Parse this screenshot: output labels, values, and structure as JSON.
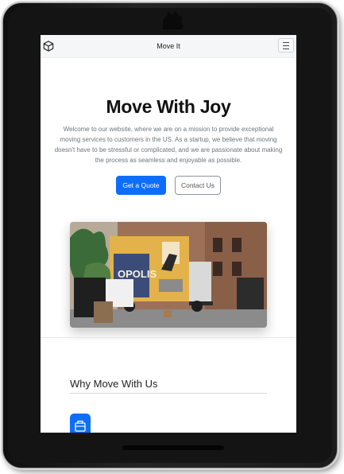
{
  "navbar": {
    "brand_icon": "box-icon",
    "title": "Move It",
    "menu_icon": "hamburger-icon"
  },
  "hero": {
    "heading": "Move With Joy",
    "description": "Welcome to our website, where we are on a mission to provide exceptional moving services to customers in the US. As a startup, we believe that moving doesn't have to be stressful or complicated, and we are passionate about making the process as seamless and enjoyable as possible.",
    "primary_button": "Get a Quote",
    "secondary_button": "Contact Us",
    "image_truck_text": "OPOLIS"
  },
  "features": {
    "heading": "Why Move With Us",
    "first_icon": "briefcase-icon"
  },
  "colors": {
    "accent": "#0d6efd",
    "muted_text": "#6c757d"
  }
}
